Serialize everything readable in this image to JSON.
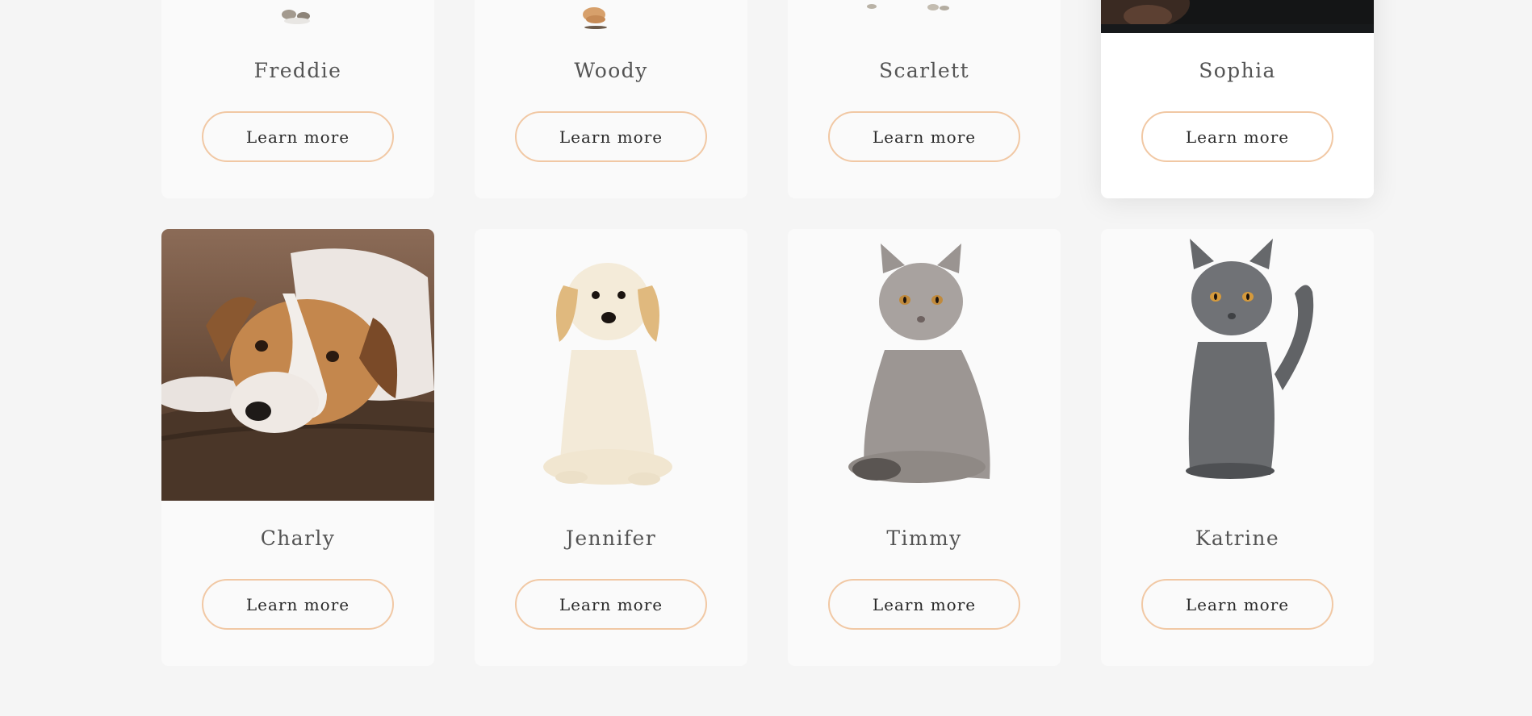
{
  "colors": {
    "page_background": "#f5f5f5",
    "card_background": "#fafafa",
    "button_border": "#f1c8a4",
    "name_text": "#545454",
    "button_text": "#292929"
  },
  "pets": [
    {
      "name": "Freddie",
      "button_label": "Learn more",
      "photo": "kitten-photo"
    },
    {
      "name": "Woody",
      "button_label": "Learn more",
      "photo": "puppy-photo"
    },
    {
      "name": "Scarlett",
      "button_label": "Learn more",
      "photo": "kitten-photo"
    },
    {
      "name": "Sophia",
      "button_label": "Learn more",
      "photo": "dark-photo",
      "hovered": true
    },
    {
      "name": "Charly",
      "button_label": "Learn more",
      "photo": "lying-dog-photo"
    },
    {
      "name": "Jennifer",
      "button_label": "Learn more",
      "photo": "cream-puppy-photo"
    },
    {
      "name": "Timmy",
      "button_label": "Learn more",
      "photo": "grey-cat-photo"
    },
    {
      "name": "Katrine",
      "button_label": "Learn more",
      "photo": "dark-grey-cat-photo"
    }
  ]
}
